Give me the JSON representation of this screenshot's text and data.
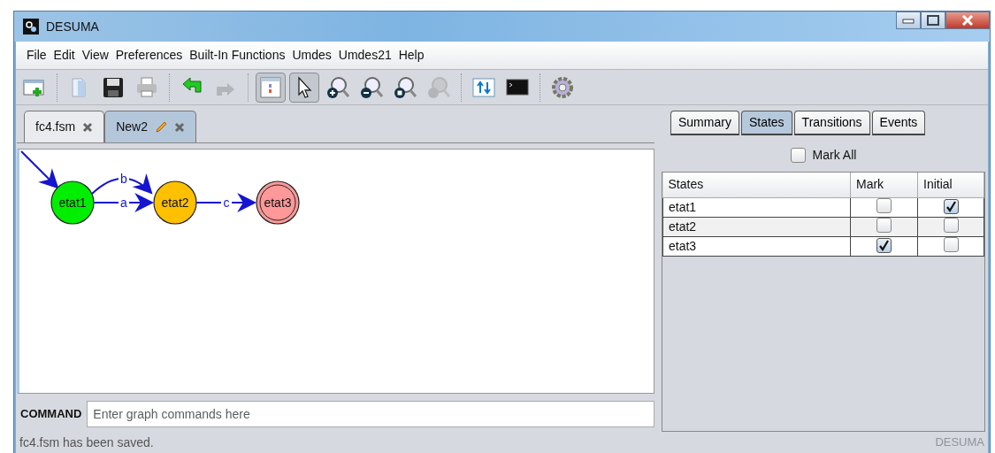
{
  "window": {
    "title": "DESUMA"
  },
  "menu": [
    "File",
    "Edit",
    "View",
    "Preferences",
    "Built-In Functions",
    "Umdes",
    "Umdes21",
    "Help"
  ],
  "toolbar": [
    {
      "kind": "new",
      "pressed": false,
      "disabled": false
    },
    {
      "kind": "separator"
    },
    {
      "kind": "open",
      "pressed": false,
      "disabled": false
    },
    {
      "kind": "save",
      "pressed": false,
      "disabled": false
    },
    {
      "kind": "print",
      "pressed": false,
      "disabled": false
    },
    {
      "kind": "separator"
    },
    {
      "kind": "undo",
      "pressed": false,
      "disabled": false
    },
    {
      "kind": "redo",
      "pressed": false,
      "disabled": true
    },
    {
      "kind": "separator"
    },
    {
      "kind": "layout",
      "pressed": true,
      "disabled": false
    },
    {
      "kind": "pointer",
      "pressed": true,
      "disabled": false
    },
    {
      "kind": "zoomin",
      "pressed": false,
      "disabled": false
    },
    {
      "kind": "zoomout",
      "pressed": false,
      "disabled": false
    },
    {
      "kind": "zoomfit",
      "pressed": false,
      "disabled": false
    },
    {
      "kind": "zoomreset",
      "pressed": false,
      "disabled": true
    },
    {
      "kind": "separator"
    },
    {
      "kind": "transfer",
      "pressed": false,
      "disabled": false
    },
    {
      "kind": "console",
      "pressed": false,
      "disabled": false
    },
    {
      "kind": "separator"
    },
    {
      "kind": "settings",
      "pressed": false,
      "disabled": false
    }
  ],
  "file_tabs": [
    {
      "label": "fc4.fsm",
      "selected": false,
      "modified": false
    },
    {
      "label": "New2",
      "selected": true,
      "modified": true
    }
  ],
  "graph": {
    "states": [
      {
        "name": "etat1",
        "color": "#00ee00",
        "initial": true,
        "marked": false,
        "transitions": [
          {
            "label": "b",
            "kind": "curved"
          },
          {
            "label": "a",
            "kind": "straight"
          }
        ]
      },
      {
        "name": "etat2",
        "color": "#ffc000",
        "initial": false,
        "marked": false,
        "transitions": [
          {
            "label": "c",
            "kind": "straight"
          }
        ]
      },
      {
        "name": "etat3",
        "color": "#ff9999",
        "initial": false,
        "marked": true
      }
    ]
  },
  "command": {
    "label": "COMMAND",
    "placeholder": "Enter graph commands here"
  },
  "side_tabs": [
    {
      "label": "Summary",
      "selected": false
    },
    {
      "label": "States",
      "selected": true
    },
    {
      "label": "Transitions",
      "selected": false
    },
    {
      "label": "Events",
      "selected": false
    }
  ],
  "mark_all": {
    "label": "Mark All",
    "checked": false
  },
  "states_table": {
    "columns": [
      "States",
      "Mark",
      "Initial"
    ],
    "rows": [
      {
        "state": "etat1",
        "mark": false,
        "initial": true
      },
      {
        "state": "etat2",
        "mark": false,
        "initial": false
      },
      {
        "state": "etat3",
        "mark": true,
        "initial": false
      }
    ]
  },
  "status_bar": {
    "message": "fc4.fsm has been saved.",
    "brand": "DESUMA"
  }
}
